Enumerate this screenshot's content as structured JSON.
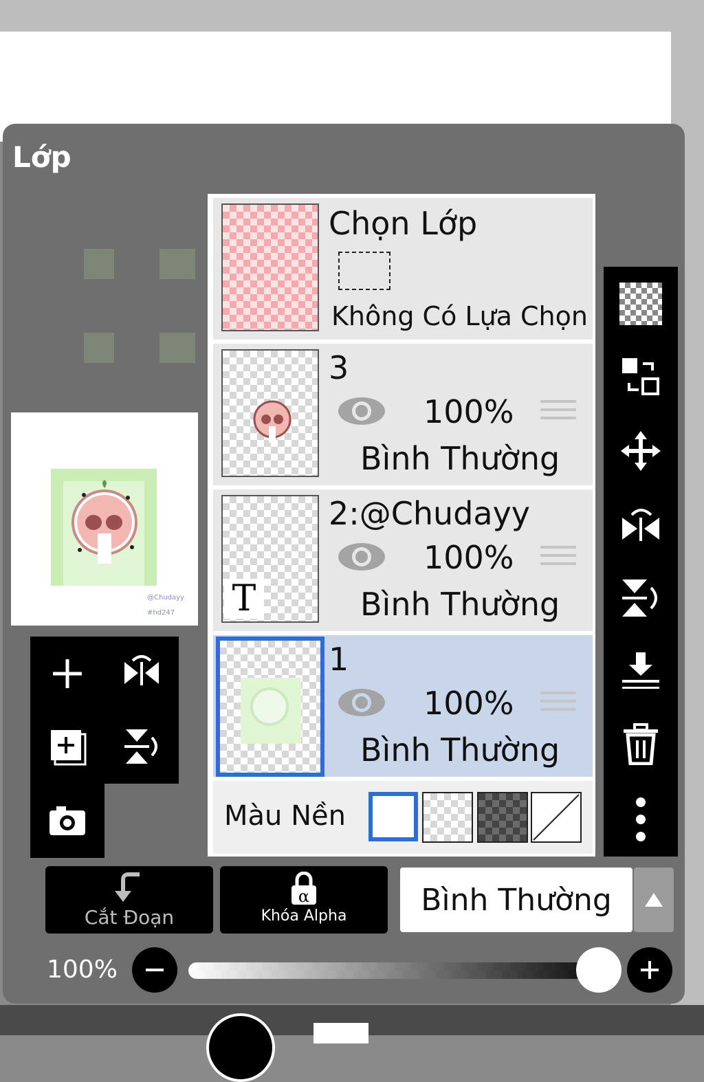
{
  "panel": {
    "title": "Lớp"
  },
  "preview": {
    "watermark_line1": "@Chudayy",
    "watermark_line2": "#hd247"
  },
  "selection_row": {
    "title": "Chọn Lớp",
    "status": "Không Có Lựa Chọn"
  },
  "layers": [
    {
      "name": "3",
      "opacity": "100%",
      "mode": "Bình Thường",
      "visible": true,
      "selected": false,
      "thumb": "sticker"
    },
    {
      "name": "2:@Chudayy",
      "opacity": "100%",
      "mode": "Bình Thường",
      "visible": true,
      "selected": false,
      "thumb": "text",
      "thumb_glyph": "T"
    },
    {
      "name": "1",
      "opacity": "100%",
      "mode": "Bình Thường",
      "visible": true,
      "selected": true,
      "thumb": "faded-sticker"
    }
  ],
  "background": {
    "label": "Màu Nền",
    "options": [
      "white",
      "checker-light",
      "checker-dark",
      "none"
    ],
    "selected": "white"
  },
  "right_toolbar": [
    "transparency-icon",
    "swap-layers-icon",
    "move-icon",
    "flip-horizontal-icon",
    "flip-vertical-icon",
    "merge-down-icon",
    "trash-icon",
    "more-icon"
  ],
  "left_toolbar": [
    "add-layer-icon",
    "flip-horizontal-icon",
    "add-copy-layer-icon",
    "flip-vertical-icon",
    "camera-icon"
  ],
  "bottom": {
    "clip_label": "Cắt Đoạn",
    "alpha_lock_label": "Khóa Alpha",
    "blend_mode": "Bình Thường",
    "opacity_label": "100%",
    "opacity_value": 1.0
  },
  "colors": {
    "selected_border": "#2b6fd6",
    "selected_row": "#c9d6ea",
    "panel": "#6f6f6f"
  }
}
